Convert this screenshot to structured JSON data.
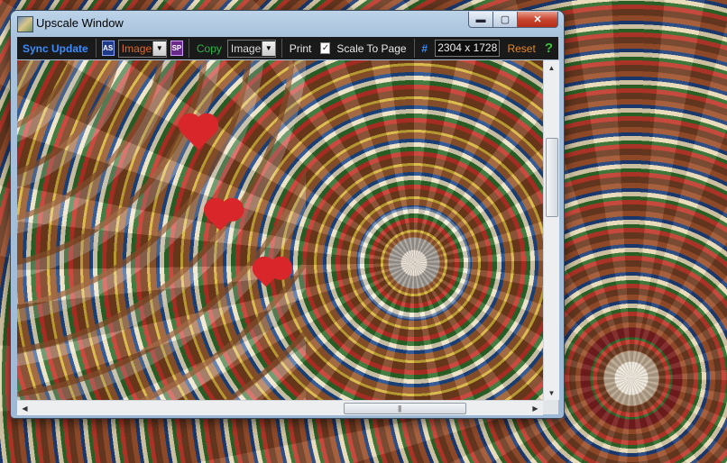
{
  "window": {
    "title": "Upscale Window",
    "controls": {
      "minimize": "▬",
      "maximize": "▢",
      "close": "✕"
    }
  },
  "toolbar": {
    "sync_update": "Sync Update",
    "as_icon_label": "AS",
    "source_dropdown": {
      "selected": "Image"
    },
    "sp_icon_label": "SP",
    "copy": "Copy",
    "copy_dropdown": {
      "selected": "Image"
    },
    "print": "Print",
    "scale_to_page": {
      "label": "Scale To Page",
      "checked": true,
      "check_glyph": "✓"
    },
    "hash": "#",
    "dimensions": "2304 x 1728",
    "reset": "Reset",
    "help": "?"
  },
  "scrollbars": {
    "up_arrow": "▲",
    "down_arrow": "▼",
    "left_arrow": "◀",
    "right_arrow": "▶",
    "grip": "|||"
  },
  "colors": {
    "toolbar_bg": "#1a1a1a",
    "link_blue": "#3a8cff",
    "copy_green": "#2fb54a",
    "reset_orange": "#e08a2a",
    "help_green": "#37c43a",
    "close_red": "#c94530"
  }
}
